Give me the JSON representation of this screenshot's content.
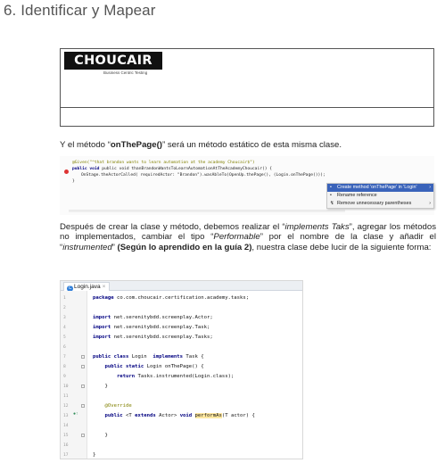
{
  "heading": "6. Identificar y Mapear",
  "logo": {
    "name": "CHOUCAIR",
    "tagline": "Business Centric Testing"
  },
  "intro": {
    "before": "Y el método “",
    "method": "onThePage()",
    "after": "” será un método estático de esta misma clase."
  },
  "snippet": {
    "lines": [
      "@Given(\"^that brandon wants to learn automation at the academy Choucair$\")",
      "public void thanBrandonWantsToLearnAutomationAtTheAcademyChoucair() {",
      "OnStage.theActorCalled( requiredActor: \"Brandon\").wasAbleTo(OpenUp.thePage(), (Login.onThePage()));",
      "}"
    ],
    "hint_label": "requiredActor:"
  },
  "context_menu": {
    "items": [
      {
        "label": "Create method 'onThePage' in 'Login'",
        "selected": true
      },
      {
        "label": "Rename reference",
        "selected": false
      },
      {
        "label": "Remove unnecessary parentheses",
        "selected": false
      }
    ]
  },
  "body": {
    "t1": "Después de crear la clase y método, debemos realizar el “",
    "i1": "implements Taks",
    "t2": "”, agregar los métodos no implementados, cambiar el tipo “",
    "i2": "Performable",
    "t3": "” por el nombre de la clase y añadir el “",
    "i3": "instrumented",
    "t4": "” ",
    "b1": "(Según lo aprendido en la guía 2)",
    "t5": ", nuestra clase debe lucir de la siguiente forma:"
  },
  "editor": {
    "tab_label": "Login.java",
    "tab_close": "×",
    "line_numbers": [
      "1",
      "2",
      "3",
      "4",
      "5",
      "6",
      "7",
      "8",
      "9",
      "10",
      "11",
      "12",
      "13",
      "14",
      "15",
      "16",
      "17"
    ],
    "lines": {
      "l1a": "package ",
      "l1b": "co.com.choucair.certification.academy.tasks;",
      "l3a": "import ",
      "l3b": "net.serenitybdd.screenplay.Actor;",
      "l4a": "import ",
      "l4b": "net.serenitybdd.screenplay.Task;",
      "l5a": "import ",
      "l5b": "net.serenitybdd.screenplay.Tasks;",
      "l7a": "public class ",
      "l7b": "Login  ",
      "l7c": "implements ",
      "l7d": "Task {",
      "l8a": "    public static ",
      "l8b": "Login onThePage() {",
      "l9a": "        return ",
      "l9b": "Tasks.instrumented(Login.class);",
      "l10": "    }",
      "l12": "    @Override",
      "l13a": "    public ",
      "l13b": "<T ",
      "l13c": "extends ",
      "l13d": "Actor> ",
      "l13e": "void ",
      "l13f": "performAs",
      "l13g": "(T actor) {",
      "l15": "    }",
      "l17": "}"
    }
  }
}
